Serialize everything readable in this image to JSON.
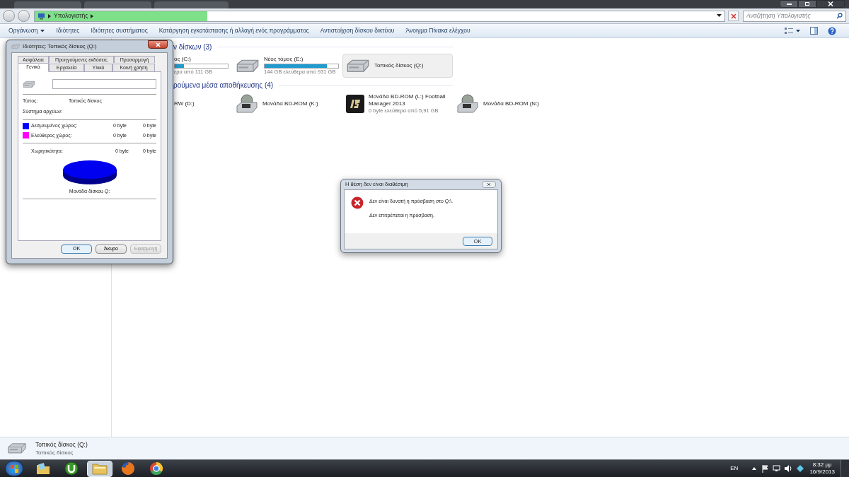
{
  "explorer": {
    "address": {
      "crumbs": [
        "Υπολογιστής"
      ],
      "level": 0.25
    },
    "search": {
      "placeholder": "Αναζήτηση Υπολογιστής"
    },
    "toolbar": [
      {
        "label": "Οργάνωση",
        "kind": "menu"
      },
      {
        "label": "Ιδιότητες",
        "kind": "button"
      },
      {
        "label": "Ιδιότητες συστήματος",
        "kind": "button"
      },
      {
        "label": "Κατάργηση εγκατάστασης ή αλλαγή ενός προγράμματος",
        "kind": "button"
      },
      {
        "label": "Αντιστοίχιση δίσκου δικτύου",
        "kind": "button"
      },
      {
        "label": "Άνοιγμα Πίνακα ελέγχου",
        "kind": "button"
      }
    ],
    "groups": [
      {
        "title": "ν δίσκων (3)",
        "items": [
          {
            "kind": "none",
            "name": "ος (C:)",
            "level": 0.17,
            "info": "ερα από 111 GB",
            "selected": false
          },
          {
            "kind": "hdd",
            "name": "Νέος τόμος (E:)",
            "level": 0.85,
            "info": "144 GB ελεύθερα από 931 GB",
            "selected": false
          },
          {
            "kind": "hdd",
            "name": "Τοπικός δίσκος (Q:)",
            "selected": true
          }
        ]
      },
      {
        "title": "ρούμενα μέσα αποθήκευσης (4)",
        "items": [
          {
            "kind": "none",
            "name": "RW (D:)",
            "selected": false
          },
          {
            "kind": "bd",
            "name": "Μονάδα BD-ROM (K:)",
            "selected": false
          },
          {
            "kind": "game",
            "name": "Μονάδα BD-ROM (L:) Football Manager 2013",
            "info": "0 byte ελεύθερα από 5,91 GB",
            "selected": false
          },
          {
            "kind": "bd",
            "name": "Μονάδα BD-ROM (N:)",
            "selected": false
          }
        ]
      }
    ],
    "details": {
      "name": "Τοπικός δίσκος (Q:)",
      "type": "Τοπικός δίσκος"
    }
  },
  "properties": {
    "title": "Ιδιότητες: Τοπικός δίσκος (Q:)",
    "tabs_back": [
      {
        "label": "Ασφάλεια",
        "selected": false
      },
      {
        "label": "Προηγούμενες εκδόσεις",
        "selected": false
      },
      {
        "label": "Προσαρμογή",
        "selected": false
      }
    ],
    "tabs_front": [
      {
        "label": "Γενικά",
        "selected": true
      },
      {
        "label": "Εργαλεία",
        "selected": false
      },
      {
        "label": "Υλικό",
        "selected": false
      },
      {
        "label": "Κοινή χρήση",
        "selected": false
      }
    ],
    "type_label": "Τύπος:",
    "type_value": "Τοπικός δίσκος",
    "fs_label": "Σύστημα αρχείων:",
    "space": [
      {
        "label": "Δεσμευμένος χώρος:",
        "color": "#0000ff",
        "bytes": "0 byte",
        "size": "0 byte"
      },
      {
        "label": "Ελεύθερος χώρος:",
        "color": "#ff00ff",
        "bytes": "0 byte",
        "size": "0 byte"
      }
    ],
    "capacity": {
      "label": "Χωρητικότητα:",
      "bytes": "0 byte",
      "size": "0 byte"
    },
    "drive_label": "Μονάδα δίσκου Q:",
    "buttons": [
      {
        "label": "OK",
        "disabled": false,
        "default": true
      },
      {
        "label": "Άκυρο",
        "disabled": false,
        "default": false
      },
      {
        "label": "Εφαρμογή",
        "disabled": true,
        "default": false
      }
    ]
  },
  "error": {
    "title": "Η θέση δεν είναι διαθέσιμη",
    "message": "Δεν είναι δυνατή η πρόσβαση στο Q:\\.",
    "detail": "Δεν επιτρέπεται η πρόσβαση.",
    "button": "OK"
  },
  "taskbar": {
    "apps": [
      {
        "kind": "libraries",
        "selected": false
      },
      {
        "kind": "torrent",
        "selected": false
      },
      {
        "kind": "explorer",
        "selected": true
      },
      {
        "kind": "firefox",
        "selected": false
      },
      {
        "kind": "chrome",
        "selected": false
      }
    ],
    "language": "EN",
    "time": "8:32 μμ",
    "date": "16/9/2013"
  }
}
